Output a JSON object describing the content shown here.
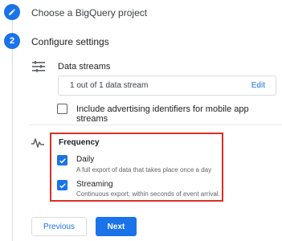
{
  "step1": {
    "number": "",
    "title": "Choose a BigQuery project",
    "icon": "pencil-icon"
  },
  "step2": {
    "number": "2",
    "title": "Configure settings",
    "data_streams": {
      "icon": "list-settings-icon",
      "title": "Data streams",
      "count_text": "1 out of 1 data stream",
      "edit_label": "Edit"
    },
    "advertising": {
      "label": "Include advertising identifiers for mobile app streams",
      "checked": false
    },
    "frequency": {
      "icon": "waveform-icon",
      "title": "Frequency",
      "options": [
        {
          "label": "Daily",
          "description": "A full export of data that takes place once a day",
          "checked": true
        },
        {
          "label": "Streaming",
          "description": "Continuous export, within seconds of event arrival.",
          "checked": true
        }
      ]
    }
  },
  "buttons": {
    "previous_label": "Previous",
    "next_label": "Next"
  },
  "colors": {
    "accent": "#1a73e8",
    "highlight_border": "#d93025"
  }
}
